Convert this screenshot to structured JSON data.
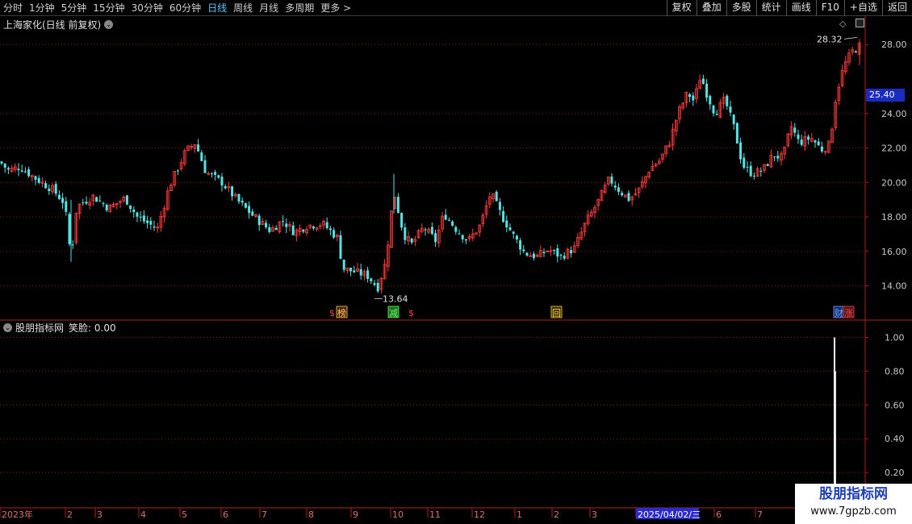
{
  "toolbar": {
    "periods": [
      "分时",
      "1分钟",
      "5分钟",
      "15分钟",
      "30分钟",
      "60分钟",
      "日线",
      "周线",
      "月线",
      "多周期",
      "更多 >"
    ],
    "active_index": 6,
    "buttons": [
      "复权",
      "叠加",
      "多股",
      "统计",
      "画线",
      "F10",
      "+自选",
      "返回"
    ]
  },
  "main_panel": {
    "title": "上海家化(日线 前复权)",
    "current_price": "25.40",
    "high_label": "28.32",
    "low_label": "13.64"
  },
  "markers": [
    {
      "label": "$",
      "color": "#ff4040"
    },
    {
      "label": "榜",
      "color": "#ffdd44"
    },
    {
      "label": "减",
      "color": "#66ff66"
    },
    {
      "label": "$",
      "color": "#ff4040"
    },
    {
      "label": "回",
      "color": "#ffdd44"
    },
    {
      "label": "财",
      "color": "#66aaff"
    },
    {
      "label": "涨",
      "color": "#ff4040"
    }
  ],
  "indicator_panel": {
    "title": "股朋指标网",
    "value_label": "笑脸: 0.00"
  },
  "watermark": {
    "title": "股朋指标网",
    "url": "www.7gpzb.com"
  },
  "chart_data": [
    {
      "type": "candlestick",
      "x_labels": [
        "2023年",
        "2",
        "3",
        "4",
        "5",
        "6",
        "7",
        "8",
        "9",
        "10",
        "11",
        "12",
        "1",
        "2",
        "3",
        "2025/04/02/三",
        "6",
        "7"
      ],
      "y_ticks": [
        14.0,
        16.0,
        18.0,
        20.0,
        22.0,
        24.0,
        28.0
      ],
      "ylim": [
        13.0,
        28.9
      ],
      "colors": {
        "up": "#ff3c3c",
        "down": "#54e4e4",
        "grid": "#7a1c1c",
        "axis": "#b02020"
      },
      "close_path": [
        [
          0,
          21.2
        ],
        [
          10,
          20.7
        ],
        [
          25,
          20.9
        ],
        [
          45,
          20.2
        ],
        [
          65,
          19.6
        ],
        [
          80,
          18.8
        ],
        [
          88,
          15.6
        ],
        [
          95,
          18.6
        ],
        [
          115,
          19.2
        ],
        [
          135,
          18.5
        ],
        [
          155,
          19.1
        ],
        [
          170,
          18.0
        ],
        [
          195,
          17.3
        ],
        [
          210,
          19.8
        ],
        [
          230,
          21.8
        ],
        [
          242,
          22.3
        ],
        [
          255,
          20.6
        ],
        [
          275,
          20.0
        ],
        [
          295,
          18.9
        ],
        [
          315,
          18.0
        ],
        [
          335,
          17.2
        ],
        [
          350,
          17.8
        ],
        [
          365,
          17.1
        ],
        [
          380,
          17.5
        ],
        [
          400,
          17.6
        ],
        [
          418,
          16.8
        ],
        [
          425,
          15.0
        ],
        [
          440,
          14.8
        ],
        [
          455,
          14.6
        ],
        [
          468,
          13.9
        ],
        [
          478,
          15.4
        ],
        [
          488,
          19.5
        ],
        [
          500,
          17.0
        ],
        [
          510,
          16.4
        ],
        [
          525,
          17.4
        ],
        [
          540,
          16.6
        ],
        [
          550,
          18.2
        ],
        [
          565,
          17.3
        ],
        [
          580,
          16.6
        ],
        [
          595,
          17.5
        ],
        [
          608,
          19.4
        ],
        [
          620,
          18.2
        ],
        [
          635,
          17.0
        ],
        [
          650,
          15.9
        ],
        [
          665,
          15.7
        ],
        [
          680,
          16.1
        ],
        [
          695,
          15.7
        ],
        [
          712,
          16.2
        ],
        [
          725,
          17.6
        ],
        [
          740,
          18.8
        ],
        [
          755,
          20.2
        ],
        [
          768,
          19.5
        ],
        [
          780,
          19.0
        ],
        [
          792,
          19.6
        ],
        [
          805,
          20.8
        ],
        [
          818,
          21.3
        ],
        [
          830,
          22.4
        ],
        [
          840,
          24.0
        ],
        [
          852,
          25.2
        ],
        [
          860,
          24.7
        ],
        [
          868,
          26.2
        ],
        [
          876,
          25.1
        ],
        [
          886,
          24.0
        ],
        [
          898,
          24.8
        ],
        [
          910,
          23.1
        ],
        [
          920,
          21.0
        ],
        [
          932,
          20.5
        ],
        [
          945,
          20.7
        ],
        [
          958,
          21.6
        ],
        [
          970,
          21.4
        ],
        [
          980,
          23.3
        ],
        [
          990,
          22.3
        ],
        [
          1005,
          22.6
        ],
        [
          1018,
          21.9
        ],
        [
          1028,
          22.2
        ],
        [
          1036,
          25.1
        ],
        [
          1046,
          26.8
        ],
        [
          1056,
          27.6
        ],
        [
          1065,
          27.9
        ]
      ]
    },
    {
      "type": "bar",
      "title": "股朋指标网",
      "y_ticks": [
        0.2,
        0.4,
        0.6,
        0.8,
        1.0
      ],
      "ylim": [
        0,
        1.05
      ],
      "signals": [
        {
          "x_position": "near last bars",
          "value": 1.0
        }
      ]
    }
  ]
}
